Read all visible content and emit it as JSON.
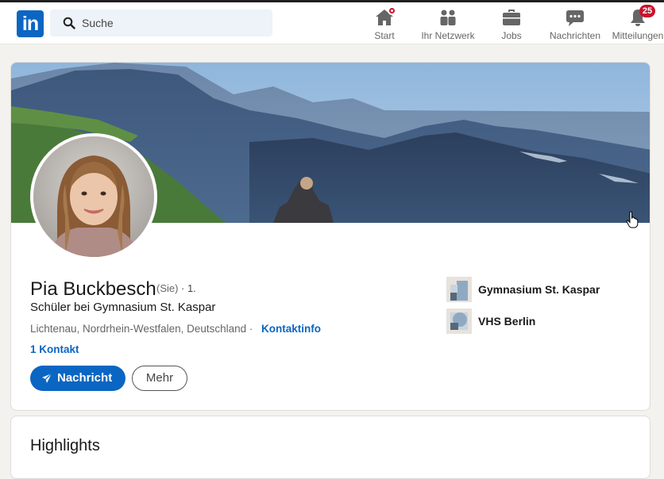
{
  "nav": {
    "logo_text": "in",
    "search_placeholder": "Suche",
    "items": [
      {
        "label": "Start",
        "icon": "home-icon"
      },
      {
        "label": "Ihr Netzwerk",
        "icon": "network-icon"
      },
      {
        "label": "Jobs",
        "icon": "briefcase-icon"
      },
      {
        "label": "Nachrichten",
        "icon": "messaging-icon"
      },
      {
        "label": "Mitteilungen",
        "icon": "bell-icon"
      }
    ],
    "notifications_count": "25"
  },
  "profile": {
    "name": "Pia Buckbesch",
    "pronoun": "(Sie)",
    "degree": "· 1.",
    "headline": "Schüler bei Gymnasium St. Kaspar",
    "location": "Lichtenau, Nordrhein-Westfalen, Deutschland ·",
    "contact_info_label": "Kontaktinfo",
    "connections": "1 Kontakt",
    "message_button": "Nachricht",
    "more_button": "Mehr",
    "organizations": [
      {
        "name": "Gymnasium St. Kaspar"
      },
      {
        "name": "VHS Berlin"
      }
    ]
  },
  "highlights": {
    "title": "Highlights"
  },
  "colors": {
    "brand": "#0a66c2",
    "badge": "#cb112d",
    "page_bg": "#f4f2ee"
  }
}
